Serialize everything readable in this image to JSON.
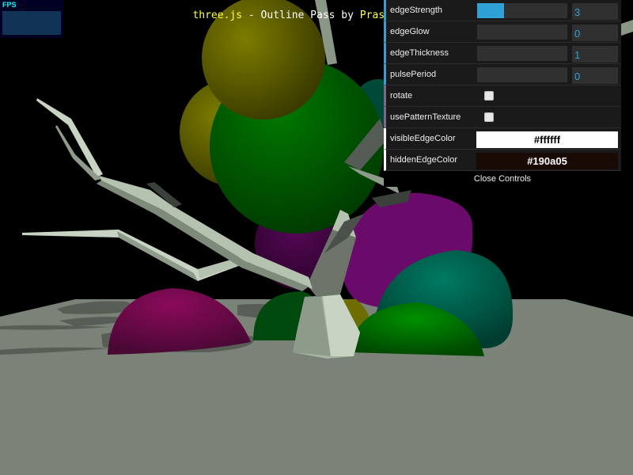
{
  "info": {
    "link1": "three.js",
    "middle": " - Outline Pass by ",
    "link2": "Prashant Shar"
  },
  "stats": {
    "label": "FPS"
  },
  "gui": {
    "controls": [
      {
        "label": "edgeStrength",
        "type": "number",
        "value": "3",
        "fill": 0.3
      },
      {
        "label": "edgeGlow",
        "type": "number",
        "value": "0",
        "fill": 0
      },
      {
        "label": "edgeThickness",
        "type": "number",
        "value": "1",
        "fill": 0
      },
      {
        "label": "pulsePeriod",
        "type": "number",
        "value": "0",
        "fill": 0
      },
      {
        "label": "rotate",
        "type": "boolean",
        "checked": false
      },
      {
        "label": "usePatternTexture",
        "type": "boolean",
        "checked": false
      },
      {
        "label": "visibleEdgeColor",
        "type": "color",
        "value": "#ffffff"
      },
      {
        "label": "hiddenEdgeColor",
        "type": "color",
        "value": "#190a05"
      }
    ],
    "close_label": "Close Controls"
  },
  "colors": {
    "gui_accent": "#2fa1d6",
    "ground": "#7b8278",
    "yellow_sphere": "#6e6e00",
    "green_sphere": "#006b00",
    "magenta_sphere": "#6a0c4a",
    "teal_sphere": "#006a56",
    "purple_sphere": "#6a0a6a",
    "tree": "#b5c2b0",
    "link": "#ffff44"
  }
}
